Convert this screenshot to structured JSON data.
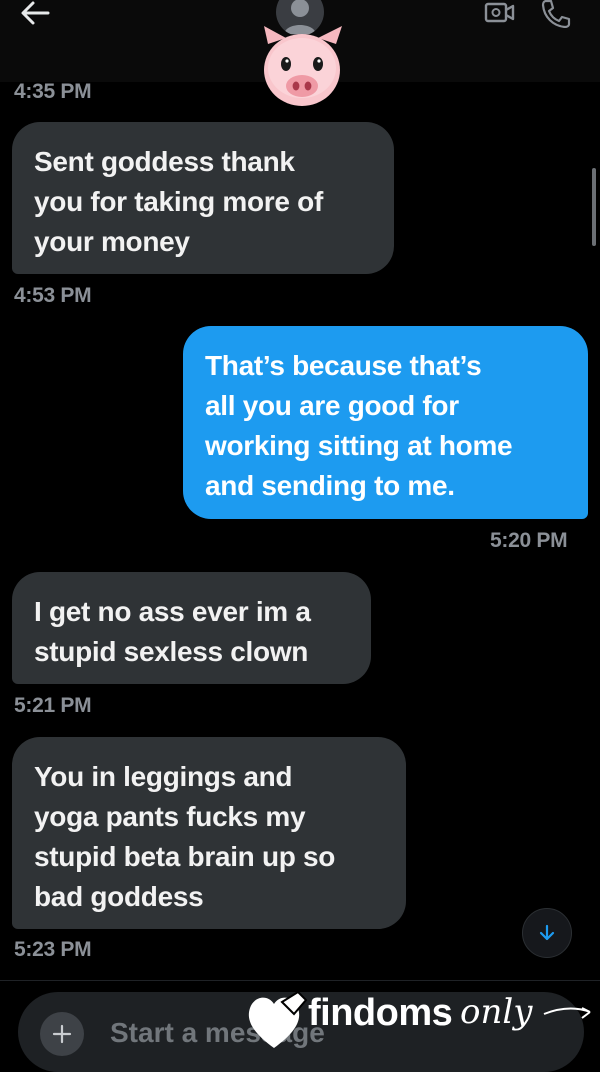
{
  "header": {
    "back_icon": "arrow-left-icon",
    "avatar_icon": "user-placeholder-icon",
    "contact_emoji": "pig-face-icon",
    "video_icon": "video-camera-icon",
    "call_icon": "phone-icon"
  },
  "messages": [
    {
      "direction": "timestamp",
      "text": "4:35 PM"
    },
    {
      "direction": "incoming",
      "lines": [
        "Sent goddess thank",
        "you for taking more of",
        "your money"
      ]
    },
    {
      "direction": "timestamp",
      "text": "4:53 PM"
    },
    {
      "direction": "outgoing",
      "lines": [
        "That’s because that’s",
        "all you are good for",
        "working sitting at home",
        "and sending to me."
      ]
    },
    {
      "direction": "timestamp",
      "text": "5:20 PM"
    },
    {
      "direction": "incoming",
      "lines": [
        "I get no ass ever im a",
        "stupid sexless clown"
      ]
    },
    {
      "direction": "timestamp",
      "text": "5:21 PM"
    },
    {
      "direction": "incoming",
      "lines": [
        "You in leggings and",
        "yoga pants fucks my",
        "stupid beta brain up so",
        "bad goddess"
      ]
    },
    {
      "direction": "timestamp",
      "text": "5:23 PM"
    }
  ],
  "composer": {
    "add_icon": "plus-icon",
    "placeholder": "Start a message",
    "scroll_down_icon": "arrow-down-icon"
  },
  "watermark": {
    "brand": "findoms",
    "script": "only",
    "logo_icon": "heart-with-tag-icon"
  },
  "colors": {
    "background": "#000000",
    "incoming_bubble": "#2f3336",
    "outgoing_bubble": "#1d9bf0",
    "timestamp": "#8b9097",
    "accent": "#1d9bf0"
  }
}
